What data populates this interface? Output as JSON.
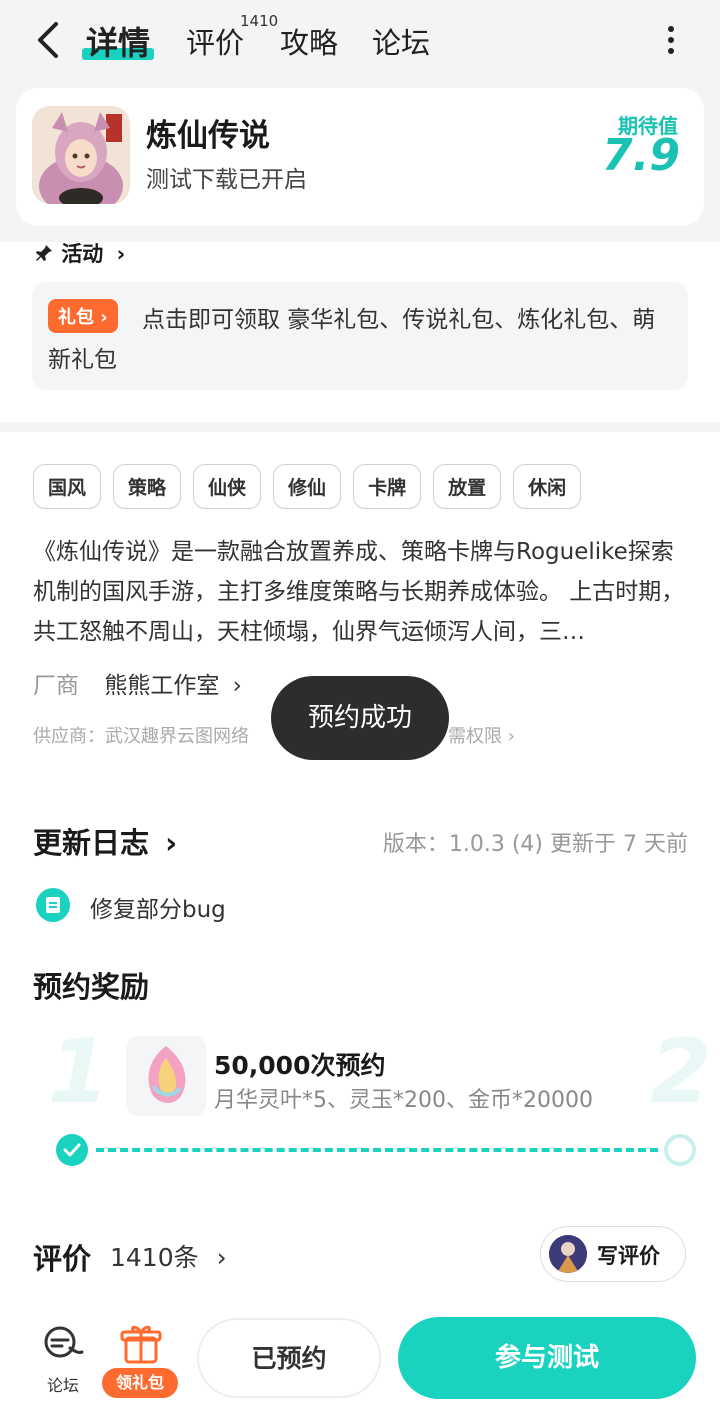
{
  "nav": {
    "tabs": [
      "详情",
      "评价",
      "攻略",
      "论坛"
    ],
    "review_badge": "1410"
  },
  "game": {
    "title": "炼仙传说",
    "subtitle": "测试下载已开启",
    "expect_label": "期待值",
    "expect_value": "7.9",
    "icon": "game-icon-art"
  },
  "activity": {
    "label": "活动",
    "gift_tag": "礼包",
    "gift_text": "点击即可领取 豪华礼包、传说礼包、炼化礼包、萌新礼包"
  },
  "tags": [
    "国风",
    "策略",
    "仙侠",
    "修仙",
    "卡牌",
    "放置",
    "休闲"
  ],
  "description": "《炼仙传说》是一款融合放置养成、策略卡牌与Roguelike探索机制的国风手游，主打多维度策略与长期养成体验。 上古时期，共工怒触不周山，天柱倾塌，仙界气运倾泻人间，三…",
  "vendor": {
    "label": "厂商",
    "name": "熊熊工作室"
  },
  "supplier": {
    "left": "供应商：武汉趣界云图网络",
    "right": "需权限"
  },
  "toast": "预约成功",
  "update_log": {
    "title": "更新日志",
    "version": "版本：1.0.3 (4)   更新于 7 天前",
    "entry": "修复部分bug"
  },
  "rewards": {
    "title": "预约奖励",
    "num1": "1",
    "num2": "2",
    "milestone_title": "50,000次预约",
    "milestone_desc": "月华灵叶*5、灵玉*200、金币*20000"
  },
  "reviews": {
    "title": "评价",
    "count": "1410条",
    "write_label": "写评价"
  },
  "bottom": {
    "forum_label": "论坛",
    "gift_label": "领礼包",
    "reserved_label": "已预约",
    "join_label": "参与测试"
  },
  "colors": {
    "accent": "#19d2c0",
    "orange": "#ff6a2e"
  }
}
